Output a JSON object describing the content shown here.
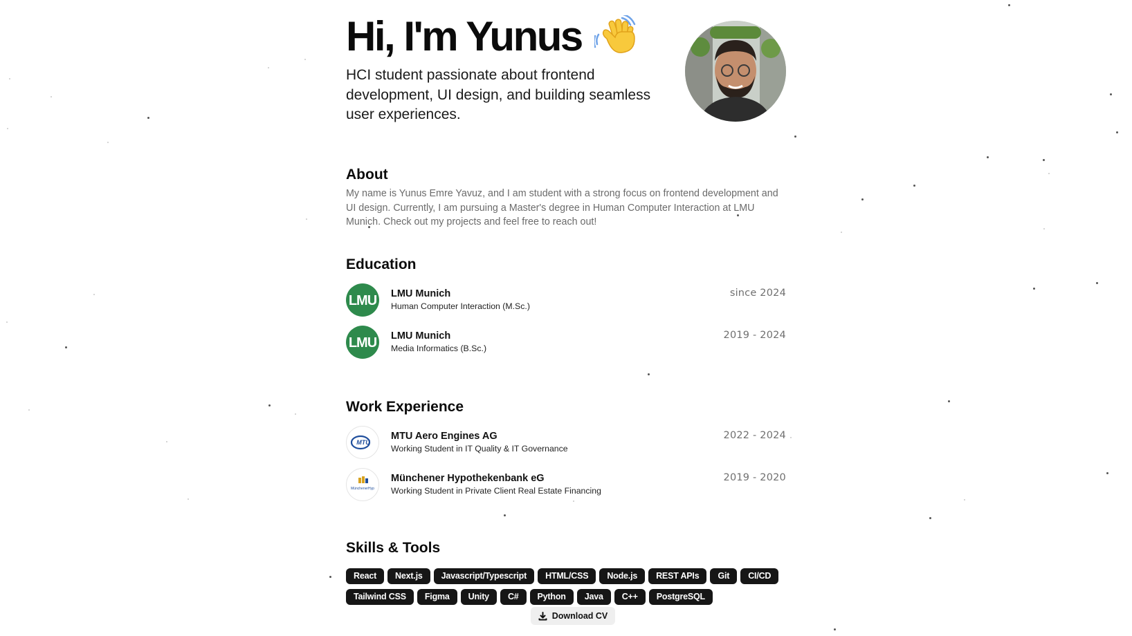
{
  "hero": {
    "heading": "Hi, I'm Yunus",
    "wave_emoji": "👋",
    "tagline": "HCI student passionate about frontend development, UI design, and building seamless user experiences."
  },
  "about": {
    "heading": "About",
    "text": "My name is Yunus Emre Yavuz, and I am student with a strong focus on frontend development and UI design. Currently, I am pursuing a Master's degree in Human Computer Interaction at LMU Munich. Check out my projects and feel free to reach out!"
  },
  "education": {
    "heading": "Education",
    "items": [
      {
        "logo_text": "LMU",
        "title": "LMU Munich",
        "subtitle": "Human Computer Interaction (M.Sc.)",
        "date": "since 2024"
      },
      {
        "logo_text": "LMU",
        "title": "LMU Munich",
        "subtitle": "Media Informatics (B.Sc.)",
        "date": "2019 - 2024"
      }
    ]
  },
  "work": {
    "heading": "Work Experience",
    "items": [
      {
        "logo_text": "MTU",
        "title": "MTU Aero Engines AG",
        "subtitle": "Working Student in IT Quality & IT Governance",
        "date": "2022 - 2024"
      },
      {
        "logo_text": "MünchenerHyp",
        "title": "Münchener Hypothekenbank eG",
        "subtitle": "Working Student in Private Client Real Estate Financing",
        "date": "2019 - 2020"
      }
    ]
  },
  "skills": {
    "heading": "Skills & Tools",
    "items": [
      "React",
      "Next.js",
      "Javascript/Typescript",
      "HTML/CSS",
      "Node.js",
      "REST APIs",
      "Git",
      "CI/CD",
      "Tailwind CSS",
      "Figma",
      "Unity",
      "C#",
      "Python",
      "Java",
      "C++",
      "PostgreSQL"
    ]
  },
  "download": {
    "label": "Download CV",
    "icon": "download-icon"
  },
  "colors": {
    "lmu_green": "#2e8a4c",
    "badge_bg": "#161616",
    "muted_text": "#6b6b6b",
    "mtu_blue": "#1f4e9c",
    "hyp_gold": "#d7a21f"
  }
}
